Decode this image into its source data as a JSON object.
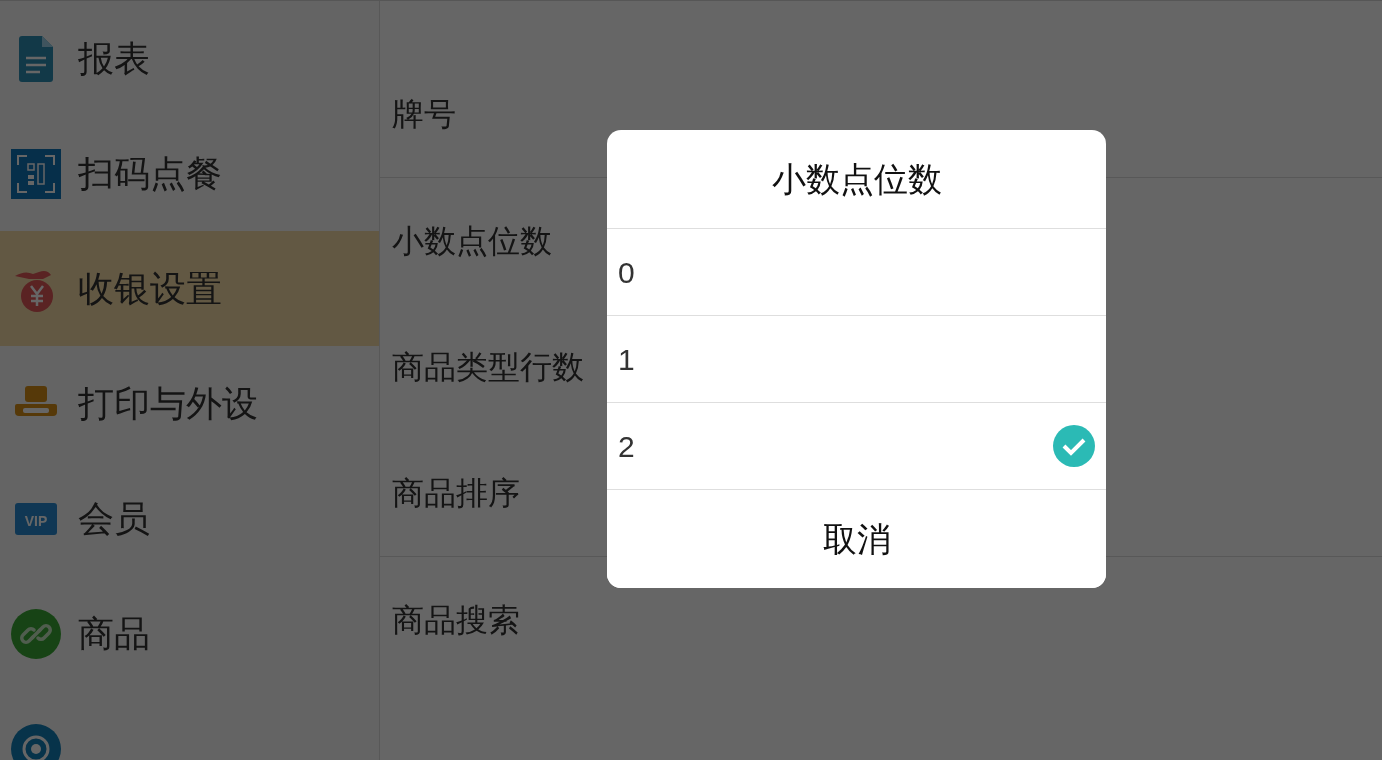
{
  "sidebar": {
    "items": [
      {
        "label": "报表",
        "kind": "document",
        "selected": false
      },
      {
        "label": "扫码点餐",
        "kind": "scan",
        "selected": false
      },
      {
        "label": "收银设置",
        "kind": "money-bag",
        "selected": true
      },
      {
        "label": "打印与外设",
        "kind": "printer",
        "selected": false
      },
      {
        "label": "会员",
        "kind": "vip",
        "icon_text": "VIP",
        "selected": false
      },
      {
        "label": "商品",
        "kind": "link",
        "selected": false
      },
      {
        "kind": "location",
        "selected": false
      }
    ]
  },
  "settings": {
    "groups": [
      [
        "牌号"
      ],
      [
        "小数点位数",
        "商品类型行数",
        "商品排序"
      ],
      [
        "商品搜索"
      ]
    ]
  },
  "dialog": {
    "title": "小数点位数",
    "options": [
      {
        "label": "0",
        "selected": false
      },
      {
        "label": "1",
        "selected": false
      },
      {
        "label": "2",
        "selected": true
      }
    ],
    "cancel": "取消"
  }
}
